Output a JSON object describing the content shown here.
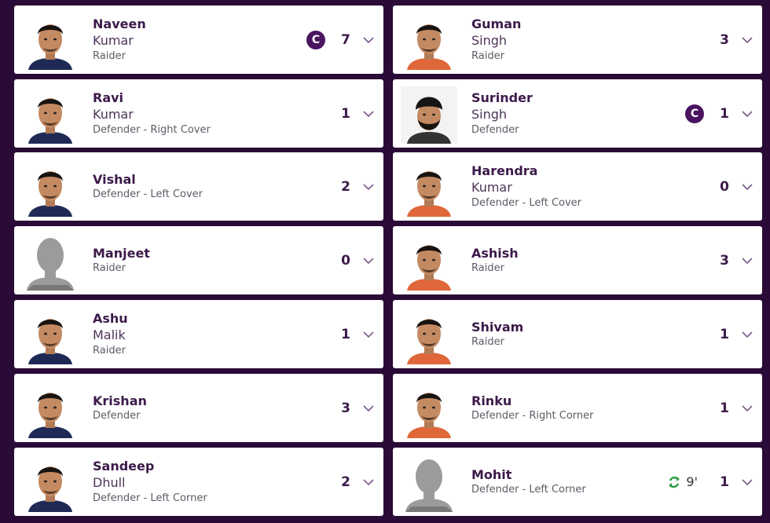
{
  "left": [
    {
      "first": "Naveen",
      "last": "Kumar",
      "position": "Raider",
      "score": "7",
      "captain": true,
      "captain_label": "C",
      "substitute": false,
      "photo": "face",
      "shirt": "#1e2a55"
    },
    {
      "first": "Ravi",
      "last": "Kumar",
      "position": "Defender - Right Cover",
      "score": "1",
      "captain": false,
      "substitute": false,
      "photo": "face",
      "shirt": "#1e2a55"
    },
    {
      "first": "Vishal",
      "last": "",
      "position": "Defender - Left Cover",
      "score": "2",
      "captain": false,
      "substitute": false,
      "photo": "face",
      "shirt": "#1e2a55"
    },
    {
      "first": "Manjeet",
      "last": "",
      "position": "Raider",
      "score": "0",
      "captain": false,
      "substitute": false,
      "photo": "silhouette",
      "shirt": "#999"
    },
    {
      "first": "Ashu",
      "last": "Malik",
      "position": "Raider",
      "score": "1",
      "captain": false,
      "substitute": false,
      "photo": "face",
      "shirt": "#1e2a55"
    },
    {
      "first": "Krishan",
      "last": "",
      "position": "Defender",
      "score": "3",
      "captain": false,
      "substitute": false,
      "photo": "face",
      "shirt": "#1e2a55"
    },
    {
      "first": "Sandeep",
      "last": "Dhull",
      "position": "Defender - Left Corner",
      "score": "2",
      "captain": false,
      "substitute": false,
      "photo": "face",
      "shirt": "#1e2a55"
    }
  ],
  "right": [
    {
      "first": "Guman",
      "last": "Singh",
      "position": "Raider",
      "score": "3",
      "captain": false,
      "substitute": false,
      "photo": "face",
      "shirt": "#e0673a"
    },
    {
      "first": "Surinder",
      "last": "Singh",
      "position": "Defender",
      "score": "1",
      "captain": true,
      "captain_label": "C",
      "substitute": false,
      "photo": "turban",
      "shirt": "#333333"
    },
    {
      "first": "Harendra",
      "last": "Kumar",
      "position": "Defender - Left Cover",
      "score": "0",
      "captain": false,
      "substitute": false,
      "photo": "face",
      "shirt": "#e0673a"
    },
    {
      "first": "Ashish",
      "last": "",
      "position": "Raider",
      "score": "3",
      "captain": false,
      "substitute": false,
      "photo": "face",
      "shirt": "#e0673a"
    },
    {
      "first": "Shivam",
      "last": "",
      "position": "Raider",
      "score": "1",
      "captain": false,
      "substitute": false,
      "photo": "face",
      "shirt": "#e0673a"
    },
    {
      "first": "Rinku",
      "last": "",
      "position": "Defender - Right Corner",
      "score": "1",
      "captain": false,
      "substitute": false,
      "photo": "face",
      "shirt": "#e0673a"
    },
    {
      "first": "Mohit",
      "last": "",
      "position": "Defender - Left Corner",
      "score": "1",
      "captain": false,
      "substitute": true,
      "sub_time": "9'",
      "photo": "silhouette",
      "shirt": "#999"
    }
  ],
  "colors": {
    "background": "#2a0a36",
    "captain": "#4a1460",
    "substitute_icon": "#2a9a3a",
    "chevron": "#7a5a8a"
  },
  "icons": {
    "chevron": "chevron-down-icon",
    "captain": "captain-badge",
    "substitute": "substitute-icon"
  }
}
